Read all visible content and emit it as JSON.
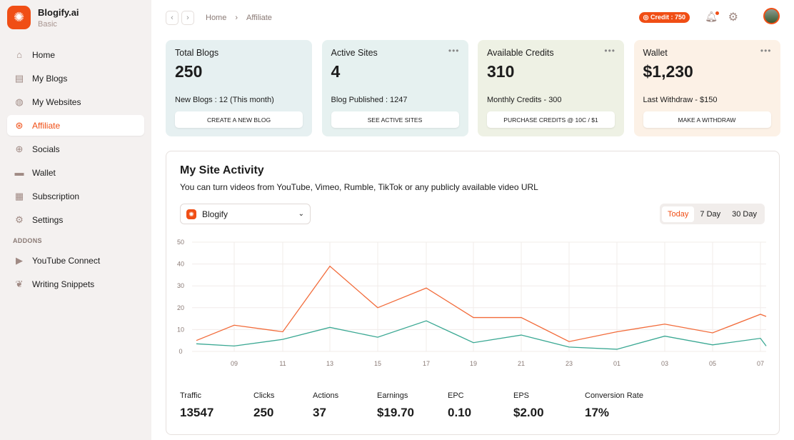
{
  "app": {
    "name": "Blogify.ai",
    "plan": "Basic"
  },
  "sidebar": {
    "items": [
      {
        "label": "Home",
        "icon": "home-icon"
      },
      {
        "label": "My Blogs",
        "icon": "blog-icon"
      },
      {
        "label": "My Websites",
        "icon": "globe-icon"
      },
      {
        "label": "Affiliate",
        "icon": "affiliate-icon",
        "active": true
      },
      {
        "label": "Socials",
        "icon": "socials-icon"
      },
      {
        "label": "Wallet",
        "icon": "wallet-icon"
      },
      {
        "label": "Subscription",
        "icon": "subscription-icon"
      },
      {
        "label": "Settings",
        "icon": "gear-icon"
      }
    ],
    "addons_label": "ADDONS",
    "addons": [
      {
        "label": "YouTube Connect",
        "icon": "youtube-icon"
      },
      {
        "label": "Writing Snippets",
        "icon": "feather-icon"
      }
    ]
  },
  "header": {
    "breadcrumb": [
      "Home",
      "Affiliate"
    ],
    "credit": "Credit : 750"
  },
  "cards": [
    {
      "title": "Total Blogs",
      "value": "250",
      "sub": "New Blogs : 12 (This month)",
      "button": "CREATE A NEW BLOG",
      "bg": "#e6f0f1"
    },
    {
      "title": "Active Sites",
      "value": "4",
      "sub": "Blog Published : 1247",
      "button": "SEE ACTIVE SITES",
      "bg": "#e6f1f0"
    },
    {
      "title": "Available Credits",
      "value": "310",
      "sub": "Monthly Credits - 300",
      "button": "PURCHASE CREDITS @ 10C / $1",
      "bg": "#eef1e4"
    },
    {
      "title": "Wallet",
      "value": "$1,230",
      "sub": "Last Withdraw - $150",
      "button": "MAKE A WITHDRAW",
      "bg": "#fcf1e6"
    }
  ],
  "activity": {
    "title": "My Site Activity",
    "subtitle": "You can turn videos from YouTube, Vimeo, Rumble, TikTok or any publicly available video URL",
    "site": "Blogify",
    "ranges": [
      "Today",
      "7 Day",
      "30 Day"
    ],
    "active_range": "Today",
    "stats": [
      {
        "label": "Traffic",
        "value": "13547"
      },
      {
        "label": "Clicks",
        "value": "250"
      },
      {
        "label": "Actions",
        "value": "37"
      },
      {
        "label": "Earnings",
        "value": "$19.70"
      },
      {
        "label": "EPC",
        "value": "0.10"
      },
      {
        "label": "EPS",
        "value": "$2.00"
      },
      {
        "label": "Conversion Rate",
        "value": "17%"
      }
    ]
  },
  "chart_data": {
    "type": "line",
    "categories": [
      "",
      "09",
      "11",
      "13",
      "15",
      "17",
      "19",
      "21",
      "23",
      "01",
      "03",
      "05",
      "07",
      ""
    ],
    "ylim": [
      0,
      50
    ],
    "yticks": [
      0,
      10,
      20,
      30,
      40,
      50
    ],
    "grid": true,
    "series": [
      {
        "color": "#f26b3a",
        "values": [
          5,
          12,
          9,
          39,
          20,
          29,
          15.5,
          15.5,
          4.5,
          9,
          12.5,
          8.5,
          17,
          16
        ]
      },
      {
        "color": "#3aa893",
        "values": [
          3.5,
          2.5,
          5.5,
          11,
          6.5,
          14,
          4,
          7.5,
          2,
          1,
          7,
          3,
          6,
          2.5
        ]
      }
    ]
  }
}
